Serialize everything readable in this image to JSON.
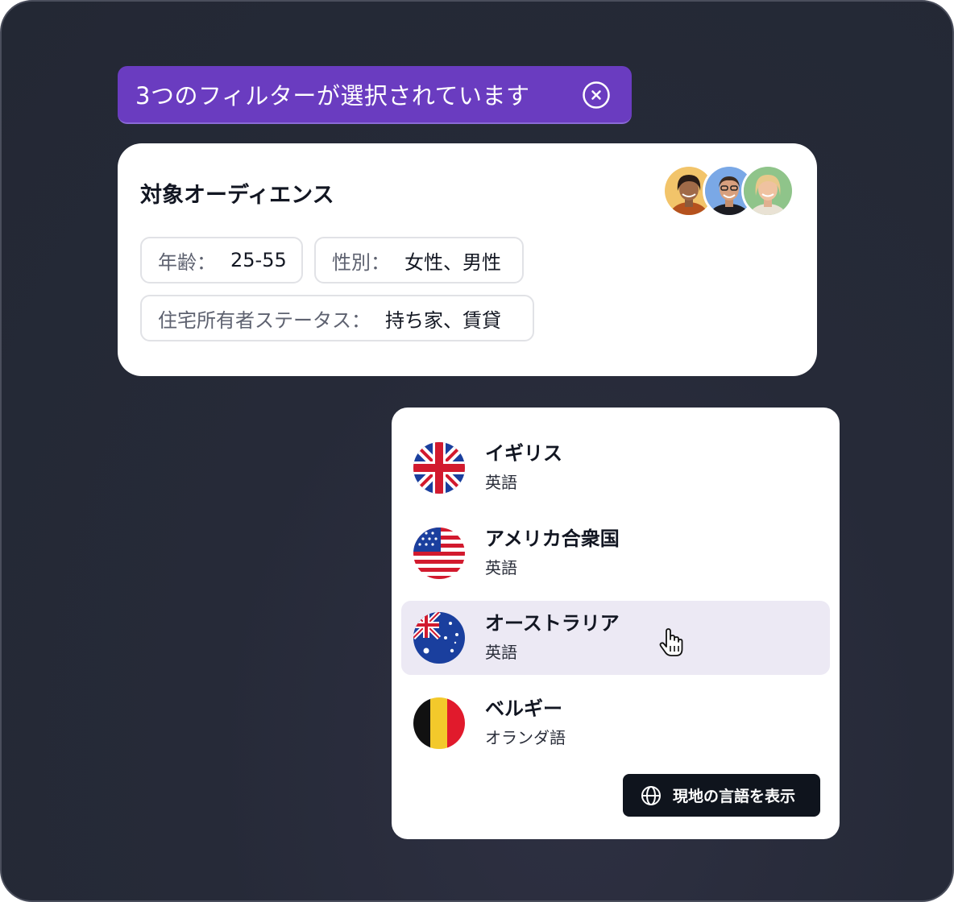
{
  "filter_bar": {
    "text": "3つのフィルターが選択されています",
    "close_icon": "close-circle-icon"
  },
  "audience": {
    "title": "対象オーディエンス",
    "avatars": [
      "avatar-woman-dark-hair",
      "avatar-man-glasses",
      "avatar-woman-blonde"
    ],
    "chips": [
      {
        "label": "年齢：",
        "value": "25-55"
      },
      {
        "label": "性別：",
        "value": "女性、男性"
      },
      {
        "label": "住宅所有者ステータス：",
        "value": "持ち家、賃貸"
      }
    ]
  },
  "countries": [
    {
      "name": "イギリス",
      "language": "英語",
      "flag": "uk-flag-icon",
      "selected": false
    },
    {
      "name": "アメリカ合衆国",
      "language": "英語",
      "flag": "us-flag-icon",
      "selected": false
    },
    {
      "name": "オーストラリア",
      "language": "英語",
      "flag": "australia-flag-icon",
      "selected": true
    },
    {
      "name": "ベルギー",
      "language": "オランダ語",
      "flag": "belgium-flag-icon",
      "selected": false
    }
  ],
  "local_language_button": {
    "label": "現地の言語を表示",
    "icon": "globe-icon"
  },
  "colors": {
    "accent": "#6a3cc0",
    "selected_row": "#ece9f4",
    "button_dark": "#0f141d"
  }
}
